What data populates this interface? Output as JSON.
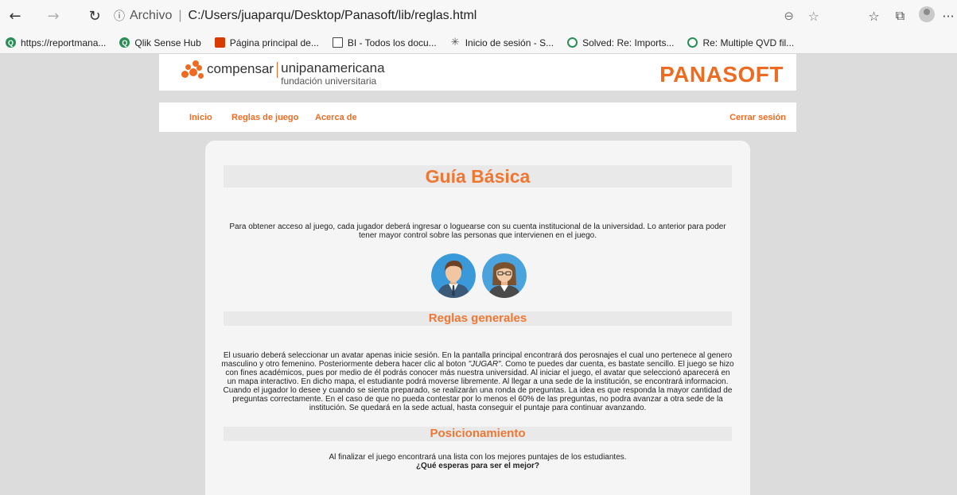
{
  "browser": {
    "back_icon": "←",
    "forward_icon": "→",
    "reload_icon": "↻",
    "info_icon": "ⓘ",
    "protocol_label": "Archivo",
    "separator": "|",
    "url": "C:/Users/juaparqu/Desktop/Panasoft/lib/reglas.html",
    "zoom_icon": "⊖",
    "star_icon": "☆",
    "favorites_icon": "☆",
    "collections_icon": "⧉",
    "more_icon": "···"
  },
  "bookmarks": [
    {
      "label": "https://reportmana...",
      "icon": "qlik-icon",
      "glyph": "Q"
    },
    {
      "label": "Qlik Sense Hub",
      "icon": "qlik-icon",
      "glyph": "Q"
    },
    {
      "label": "Página principal de...",
      "icon": "office-icon",
      "glyph": ""
    },
    {
      "label": "BI - Todos los docu...",
      "icon": "document-icon",
      "glyph": ""
    },
    {
      "label": "Inicio de sesión - S...",
      "icon": "spark-icon",
      "glyph": "✳"
    },
    {
      "label": "Solved: Re: Imports...",
      "icon": "qlik-community-icon",
      "glyph": ""
    },
    {
      "label": "Re: Multiple QVD fil...",
      "icon": "qlik-community-icon",
      "glyph": ""
    }
  ],
  "header": {
    "brand": "compensar",
    "university_line1": "unipanamericana",
    "university_line2": "fundación universitaria",
    "app_title": "PANASOFT"
  },
  "nav": {
    "home": "Inicio",
    "rules": "Reglas de juego",
    "about": "Acerca de",
    "logout": "Cerrar sesión"
  },
  "content": {
    "title": "Guía Básica",
    "intro": "Para obtener acceso al juego, cada jugador deberá ingresar o loguearse con su cuenta institucional de la universidad. Lo anterior para poder tener mayor control sobre las personas que intervienen en el juego.",
    "rules_title": "Reglas generales",
    "rules_text_before": "El usuario deberá seleccionar un avatar apenas inicie sesión. En la pantalla principal encontrará dos perosnajes el cual uno pertenece al genero masculino y otro femenino. Posteriormente debera hacer clic al boton ",
    "rules_text_em": "\"JUGAR\"",
    "rules_text_after": ". Como te puedes dar cuenta, es bastate sencillo. El juego se hizo con fines académicos, pues por medio de él podrás conocer más nuestra universidad. Al iniciar el juego, el avatar que seleccionó aparecerá en un mapa interactivo. En dicho mapa, el estudiante podrá moverse libremente. Al llegar a una sede de la institución, se encontrará informacion. Cuando el jugador lo desee y cuando se sienta preparado, se realizarán una ronda de preguntas. La idea es que responda la mayor cantidad de preguntas correctamente. En el caso de que no pueda contestar por lo menos el 60% de las preguntas, no podra avanzar a otra sede de la institución. Se quedará en la sede actual, hasta conseguir el puntaje para continuar avanzando.",
    "ranking_title": "Posicionamiento",
    "ranking_text": "Al finalizar el juego encontrará una lista con los mejores puntajes de los estudiantes.",
    "ranking_cta": "¿Qué esperas para ser el mejor?"
  },
  "colors": {
    "accent": "#ee6b22",
    "page_bg": "#dcdcdc",
    "card_bg": "#f5f5f5",
    "band_bg": "#e9e9e9"
  }
}
